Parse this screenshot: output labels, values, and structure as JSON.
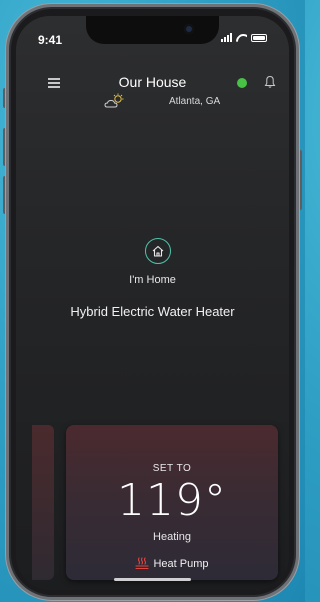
{
  "status_bar": {
    "time": "9:41"
  },
  "header": {
    "title": "Our House",
    "location": "Atlanta, GA",
    "status_color": "#48c244"
  },
  "icons": {
    "menu": "menu-icon",
    "weather": "partly-cloudy-icon",
    "notifications": "bell-icon",
    "home": "home-icon",
    "heat_pump": "heat-pump-icon"
  },
  "main": {
    "mode_label": "I'm Home",
    "device_name": "Hybrid Electric Water Heater"
  },
  "card": {
    "set_label": "SET TO",
    "temperature": "119°",
    "state": "Heating",
    "mode": "Heat Pump"
  },
  "colors": {
    "accent_teal": "#4ec3aa",
    "heat_red": "#e0443d"
  }
}
